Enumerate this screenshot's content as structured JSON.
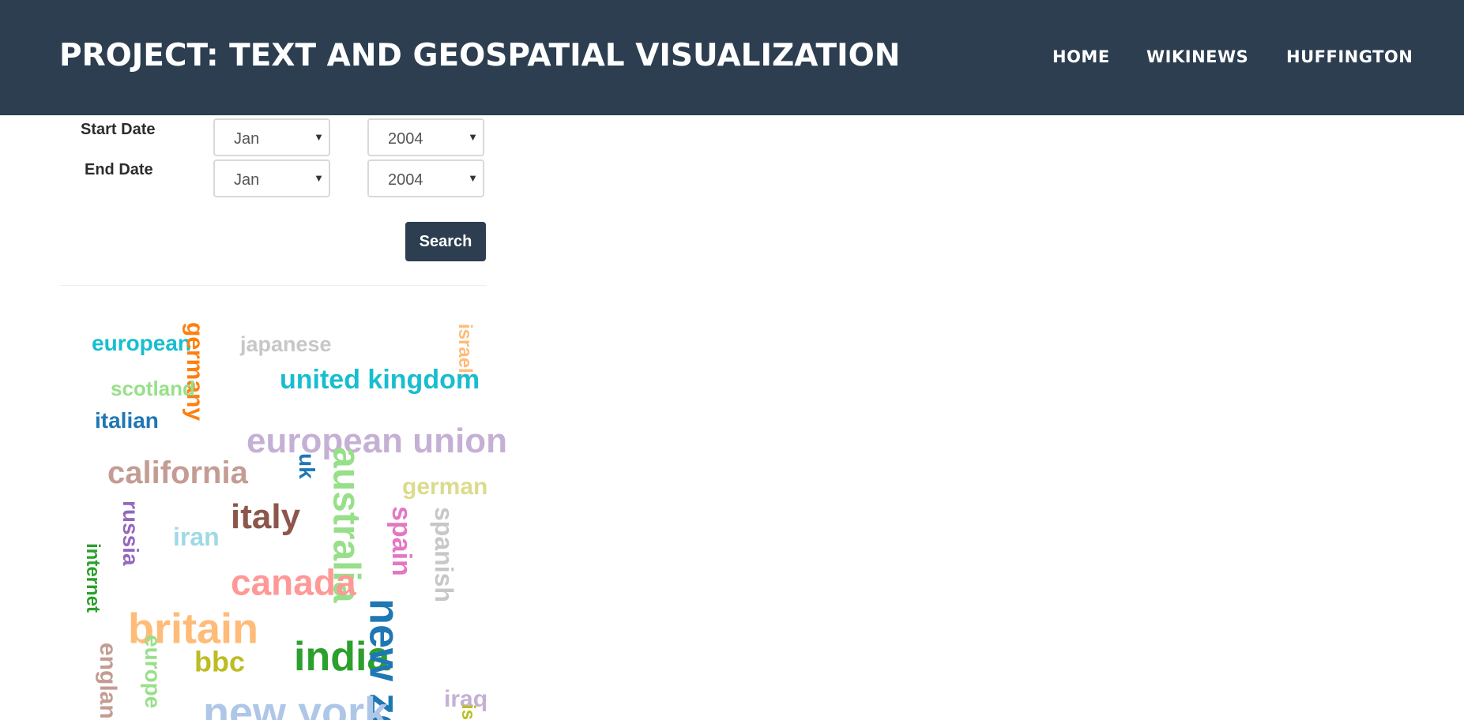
{
  "header": {
    "title": "PROJECT: TEXT AND GEOSPATIAL VISUALIZATION",
    "nav": [
      "HOME",
      "WIKINEWS",
      "HUFFINGTON"
    ]
  },
  "form": {
    "start_label": "Start Date",
    "end_label": "End Date",
    "start_month": "Jan",
    "start_year": "2004",
    "end_month": "Jan",
    "end_year": "2004",
    "search_label": "Search"
  },
  "colors": {
    "navbar": "#2c3e50",
    "button": "#2c3e50"
  },
  "word_cloud": [
    {
      "text": "european",
      "color": "#17becf",
      "rotate": 0
    },
    {
      "text": "germany",
      "color": "#ff7f0e",
      "rotate": 90
    },
    {
      "text": "japanese",
      "color": "#c7c7c7",
      "rotate": 0
    },
    {
      "text": "israeli",
      "color": "#ffbb78",
      "rotate": 90
    },
    {
      "text": "united kingdom",
      "color": "#17becf",
      "rotate": 0
    },
    {
      "text": "scotland",
      "color": "#98df8a",
      "rotate": 0
    },
    {
      "text": "italian",
      "color": "#1f77b4",
      "rotate": 0
    },
    {
      "text": "european union",
      "color": "#c5b0d5",
      "rotate": 0
    },
    {
      "text": "california",
      "color": "#c49c94",
      "rotate": 0
    },
    {
      "text": "uk",
      "color": "#1f77b4",
      "rotate": 90
    },
    {
      "text": "australia",
      "color": "#98df8a",
      "rotate": 90
    },
    {
      "text": "german",
      "color": "#dbdb8d",
      "rotate": 0
    },
    {
      "text": "italy",
      "color": "#8c564b",
      "rotate": 0
    },
    {
      "text": "russia",
      "color": "#9467bd",
      "rotate": 90
    },
    {
      "text": "iran",
      "color": "#9edae5",
      "rotate": 0
    },
    {
      "text": "spain",
      "color": "#e377c2",
      "rotate": 90
    },
    {
      "text": "spanish",
      "color": "#c7c7c7",
      "rotate": 90
    },
    {
      "text": "canada",
      "color": "#ff9896",
      "rotate": 0
    },
    {
      "text": "internet",
      "color": "#2ca02c",
      "rotate": 90
    },
    {
      "text": "britain",
      "color": "#ffbb78",
      "rotate": 0
    },
    {
      "text": "india",
      "color": "#2ca02c",
      "rotate": 0
    },
    {
      "text": "new ze",
      "color": "#1f77b4",
      "rotate": 90
    },
    {
      "text": "bbc",
      "color": "#bcbd22",
      "rotate": 0
    },
    {
      "text": "england",
      "color": "#c49c94",
      "rotate": 90
    },
    {
      "text": "europe",
      "color": "#98df8a",
      "rotate": 90
    },
    {
      "text": "new york",
      "color": "#aec7e8",
      "rotate": 0
    },
    {
      "text": "iraq",
      "color": "#c5b0d5",
      "rotate": 0
    },
    {
      "text": "is",
      "color": "#bcbd22",
      "rotate": 90
    }
  ]
}
